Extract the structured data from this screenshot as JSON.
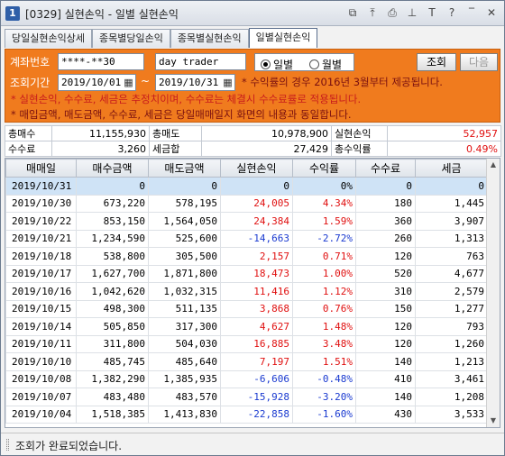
{
  "window": {
    "badge": "1",
    "title": "[0329] 실현손익 - 일별 실현손익",
    "icons": [
      "window-restore-icon",
      "pin-top-icon",
      "print-icon",
      "pin-icon",
      "text-icon",
      "help-icon",
      "minimize-icon",
      "close-icon"
    ],
    "icon_glyphs": [
      "⧉",
      "⤒",
      "⎙",
      "⊥",
      "T",
      "?",
      "‾",
      "✕"
    ]
  },
  "tabs": [
    {
      "label": "당일실현손익상세",
      "active": false
    },
    {
      "label": "종목별당일손익",
      "active": false
    },
    {
      "label": "종목별실현손익",
      "active": false
    },
    {
      "label": "일별실현손익",
      "active": true
    }
  ],
  "search": {
    "account_label": "계좌번호",
    "account_value": "****-**30",
    "account_name": "day trader",
    "period_label": "조회기간",
    "date_from": "2019/10/01",
    "date_to": "2019/10/31",
    "tilde": "~",
    "radio_daily": "일별",
    "radio_monthly": "월별",
    "query_button": "조회",
    "next_button": "다음",
    "note1": "* 수익률의 경우 2016년 3월부터 제공됩니다.",
    "note2": "* 실현손익, 수수료, 세금은 추정치이며, 수수료는 체결시 수수료률로 적용됩니다.",
    "note3": "* 매입금액, 매도금액, 수수료, 세금은 당일매매일지 화면의 내용과 동일합니다."
  },
  "summary": {
    "total_buy_label": "총매수",
    "total_buy": "11,155,930",
    "total_sell_label": "총매도",
    "total_sell": "10,978,900",
    "realized_pl_label": "실현손익",
    "realized_pl": "52,957",
    "fee_label": "수수료",
    "fee": "3,260",
    "tax_label": "세금합",
    "tax": "27,429",
    "yield_label": "총수익률",
    "yield": "0.49%"
  },
  "grid": {
    "headers": [
      "매매일",
      "매수금액",
      "매도금액",
      "실현손익",
      "수익률",
      "수수료",
      "세금"
    ],
    "rows": [
      [
        "2019/10/31",
        "0",
        "0",
        "0",
        "0%",
        "0",
        "0"
      ],
      [
        "2019/10/30",
        "673,220",
        "578,195",
        "24,005",
        "4.34%",
        "180",
        "1,445"
      ],
      [
        "2019/10/22",
        "853,150",
        "1,564,050",
        "24,384",
        "1.59%",
        "360",
        "3,907"
      ],
      [
        "2019/10/21",
        "1,234,590",
        "525,600",
        "-14,663",
        "-2.72%",
        "260",
        "1,313"
      ],
      [
        "2019/10/18",
        "538,800",
        "305,500",
        "2,157",
        "0.71%",
        "120",
        "763"
      ],
      [
        "2019/10/17",
        "1,627,700",
        "1,871,800",
        "18,473",
        "1.00%",
        "520",
        "4,677"
      ],
      [
        "2019/10/16",
        "1,042,620",
        "1,032,315",
        "11,416",
        "1.12%",
        "310",
        "2,579"
      ],
      [
        "2019/10/15",
        "498,300",
        "511,135",
        "3,868",
        "0.76%",
        "150",
        "1,277"
      ],
      [
        "2019/10/14",
        "505,850",
        "317,300",
        "4,627",
        "1.48%",
        "120",
        "793"
      ],
      [
        "2019/10/11",
        "311,800",
        "504,030",
        "16,885",
        "3.48%",
        "120",
        "1,260"
      ],
      [
        "2019/10/10",
        "485,745",
        "485,640",
        "7,197",
        "1.51%",
        "140",
        "1,213"
      ],
      [
        "2019/10/08",
        "1,382,290",
        "1,385,935",
        "-6,606",
        "-0.48%",
        "410",
        "3,461"
      ],
      [
        "2019/10/07",
        "483,480",
        "483,570",
        "-15,928",
        "-3.20%",
        "140",
        "1,208"
      ],
      [
        "2019/10/04",
        "1,518,385",
        "1,413,830",
        "-22,858",
        "-1.60%",
        "430",
        "3,533"
      ]
    ],
    "selected_row": 0,
    "positive_color": "#e01010",
    "negative_color": "#1a3ad0"
  },
  "status": {
    "text": "조회가 완료되었습니다."
  }
}
